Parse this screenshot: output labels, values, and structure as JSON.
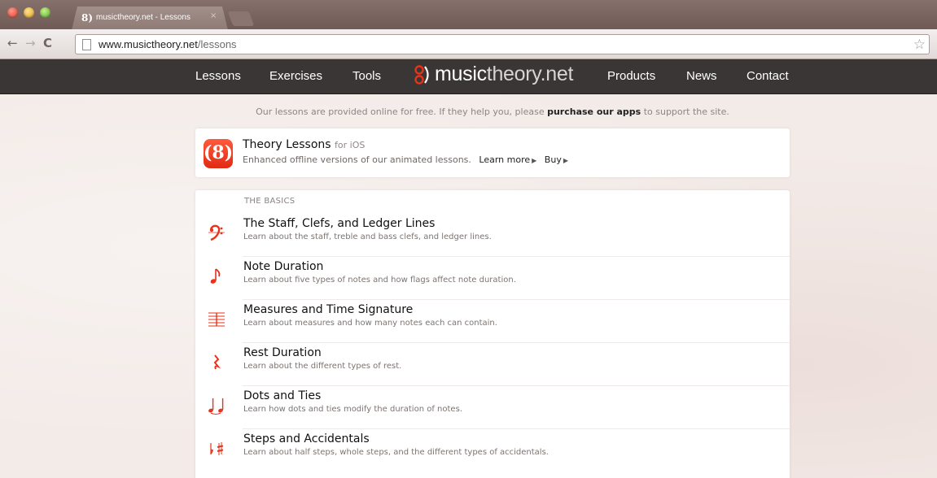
{
  "browser": {
    "tab_title": "musictheory.net - Lessons",
    "tab_close": "×",
    "url_host": "www.musictheory.net",
    "url_path": "/lessons",
    "back_glyph": "←",
    "forward_glyph": "→",
    "reload_glyph": "C",
    "star_glyph": "☆",
    "icons": [
      "back-icon",
      "forward-icon",
      "reload-icon",
      "page-icon",
      "star-icon"
    ]
  },
  "site_nav": {
    "left": [
      {
        "label": "Lessons"
      },
      {
        "label": "Exercises"
      },
      {
        "label": "Tools"
      }
    ],
    "right": [
      {
        "label": "Products"
      },
      {
        "label": "News"
      },
      {
        "label": "Contact"
      }
    ],
    "logo_bold": "music",
    "logo_light": "theory.net"
  },
  "intro": {
    "prefix": "Our lessons are provided online for free. If they help you, please ",
    "link": "purchase our apps",
    "suffix": " to support the site."
  },
  "promo": {
    "title": "Theory Lessons",
    "title_sub": "for iOS",
    "description": "Enhanced offline versions of our animated lessons.",
    "learn_more": "Learn more",
    "buy": "Buy",
    "arrow": "▶",
    "icon_color": "#e8321a"
  },
  "lessons": {
    "section_title": "THE BASICS",
    "items": [
      {
        "title": "The Staff, Clefs, and Ledger Lines",
        "description": "Learn about the staff, treble and bass clefs, and ledger lines.",
        "icon": "bass-clef-icon"
      },
      {
        "title": "Note Duration",
        "description": "Learn about five types of notes and how flags affect note duration.",
        "icon": "eighth-note-icon"
      },
      {
        "title": "Measures and Time Signature",
        "description": "Learn about measures and how many notes each can contain.",
        "icon": "staff-measure-icon"
      },
      {
        "title": "Rest Duration",
        "description": "Learn about the different types of rest.",
        "icon": "rest-icon"
      },
      {
        "title": "Dots and Ties",
        "description": "Learn how dots and ties modify the duration of notes.",
        "icon": "tied-notes-icon"
      },
      {
        "title": "Steps and Accidentals",
        "description": "Learn about half steps, whole steps, and the different types of accidentals.",
        "icon": "accidentals-icon"
      }
    ]
  },
  "colors": {
    "accent": "#e8321a",
    "header_bg": "#3a3636",
    "page_bg": "#f3ebe8"
  }
}
